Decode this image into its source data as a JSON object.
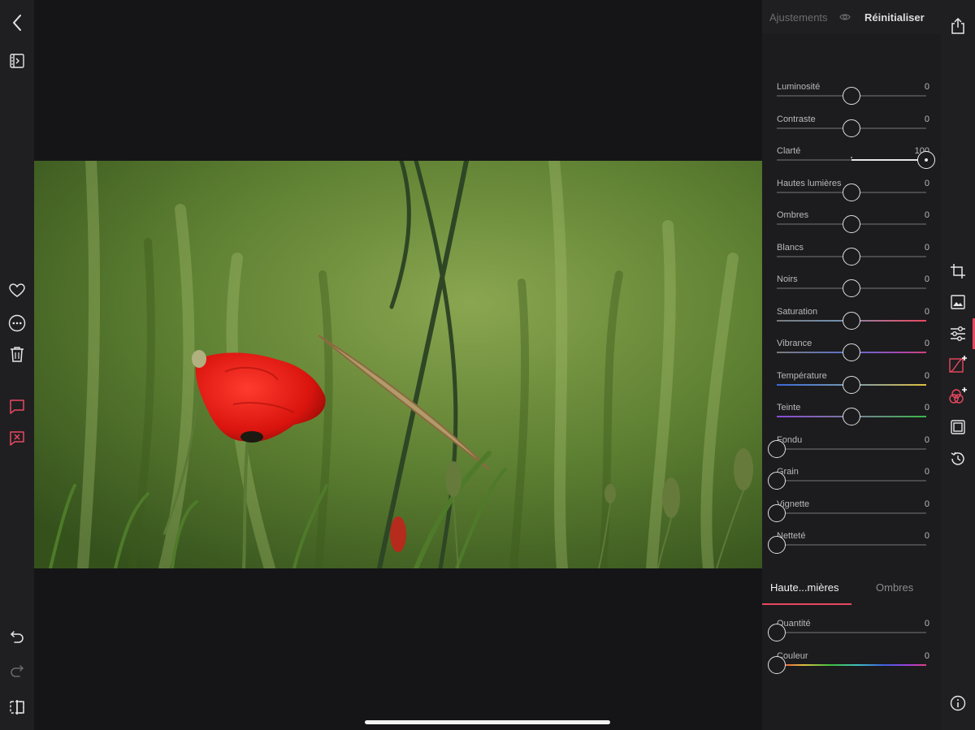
{
  "header": {
    "panel_title": "Ajustements",
    "reset_label": "Réinitialiser"
  },
  "adjustments": [
    {
      "label": "Luminosité",
      "value": "0",
      "level": 0.5,
      "gradient": "neutral"
    },
    {
      "label": "Contraste",
      "value": "0",
      "level": 0.5,
      "gradient": "neutral"
    },
    {
      "label": "Clarté",
      "value": "100",
      "level": 1.0,
      "gradient": "filled"
    },
    {
      "label": "Hautes lumières",
      "value": "0",
      "level": 0.5,
      "gradient": "neutral"
    },
    {
      "label": "Ombres",
      "value": "0",
      "level": 0.5,
      "gradient": "neutral"
    },
    {
      "label": "Blancs",
      "value": "0",
      "level": 0.5,
      "gradient": "neutral"
    },
    {
      "label": "Noirs",
      "value": "0",
      "level": 0.5,
      "gradient": "neutral"
    },
    {
      "label": "Saturation",
      "value": "0",
      "level": 0.5,
      "gradient": "saturation"
    },
    {
      "label": "Vibrance",
      "value": "0",
      "level": 0.5,
      "gradient": "vibrance"
    },
    {
      "label": "Température",
      "value": "0",
      "level": 0.5,
      "gradient": "temperature"
    },
    {
      "label": "Teinte",
      "value": "0",
      "level": 0.5,
      "gradient": "tint"
    },
    {
      "label": "Fondu",
      "value": "0",
      "level": 0.0,
      "gradient": "neutral"
    },
    {
      "label": "Grain",
      "value": "0",
      "level": 0.0,
      "gradient": "neutral"
    },
    {
      "label": "Vignette",
      "value": "0",
      "level": 0.0,
      "gradient": "neutral"
    },
    {
      "label": "Netteté",
      "value": "0",
      "level": 0.0,
      "gradient": "neutral"
    }
  ],
  "split_toning": {
    "tabs": [
      {
        "label": "Haute...mières",
        "active": true
      },
      {
        "label": "Ombres",
        "active": false
      }
    ],
    "sliders": [
      {
        "label": "Quantité",
        "value": "0",
        "level": 0.0,
        "gradient": "neutral"
      },
      {
        "label": "Couleur",
        "value": "0",
        "level": 0.0,
        "gradient": "hue"
      }
    ]
  },
  "left_toolbar": [
    "back-icon",
    "browse-icon",
    "heart-icon",
    "more-icon",
    "trash-icon",
    "comment-icon",
    "reject-icon",
    "undo-icon",
    "redo-icon",
    "compare-icon"
  ],
  "right_toolbar": [
    "share-icon",
    "crop-icon",
    "image-icon",
    "adjust-icon",
    "curves-icon",
    "color-mix-icon",
    "frame-icon",
    "history-icon",
    "info-icon"
  ],
  "colors": {
    "accent": "#e8485f",
    "panel_bg": "#1c1c1e",
    "toolbar_bg": "#1f1f21"
  }
}
